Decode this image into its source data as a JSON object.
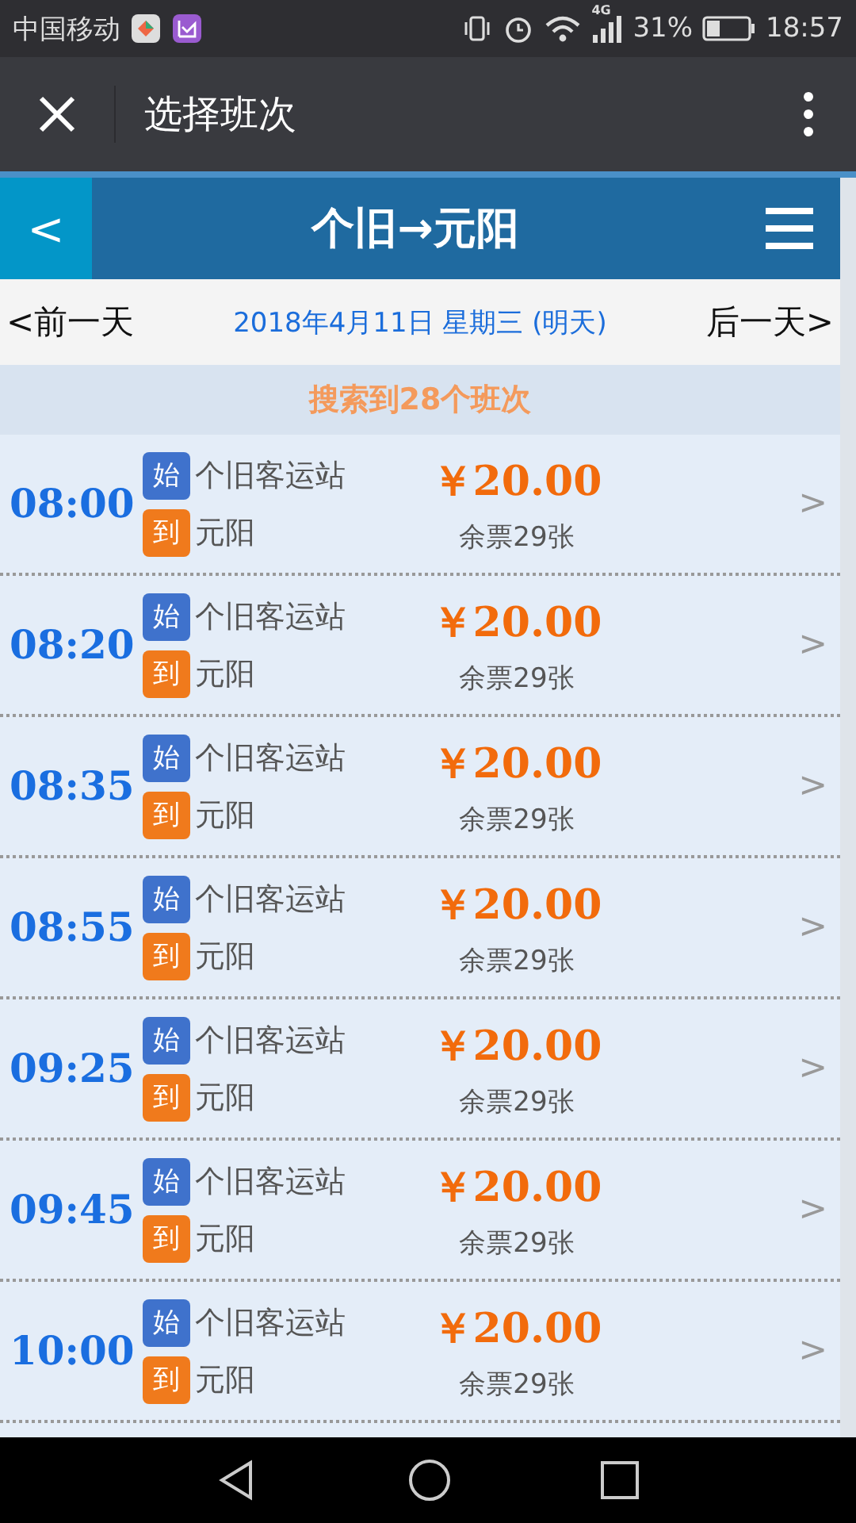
{
  "status_bar": {
    "carrier": "中国移动",
    "network": "4G",
    "battery": "31%",
    "time": "18:57"
  },
  "app_bar": {
    "title": "选择班次"
  },
  "header": {
    "back": "<",
    "title": "个旧→元阳"
  },
  "date_bar": {
    "prev": "<前一天",
    "date": "2018年4月11日 星期三 (明天)",
    "next": "后一天>"
  },
  "result_count": "搜索到28个班次",
  "trips": [
    {
      "time": "08:00",
      "from_badge": "始",
      "from": "个旧客运站",
      "to_badge": "到",
      "to": "元阳",
      "price": "￥20.00",
      "remaining": "余票29张",
      "chevron": ">"
    },
    {
      "time": "08:20",
      "from_badge": "始",
      "from": "个旧客运站",
      "to_badge": "到",
      "to": "元阳",
      "price": "￥20.00",
      "remaining": "余票29张",
      "chevron": ">"
    },
    {
      "time": "08:35",
      "from_badge": "始",
      "from": "个旧客运站",
      "to_badge": "到",
      "to": "元阳",
      "price": "￥20.00",
      "remaining": "余票29张",
      "chevron": ">"
    },
    {
      "time": "08:55",
      "from_badge": "始",
      "from": "个旧客运站",
      "to_badge": "到",
      "to": "元阳",
      "price": "￥20.00",
      "remaining": "余票29张",
      "chevron": ">"
    },
    {
      "time": "09:25",
      "from_badge": "始",
      "from": "个旧客运站",
      "to_badge": "到",
      "to": "元阳",
      "price": "￥20.00",
      "remaining": "余票29张",
      "chevron": ">"
    },
    {
      "time": "09:45",
      "from_badge": "始",
      "from": "个旧客运站",
      "to_badge": "到",
      "to": "元阳",
      "price": "￥20.00",
      "remaining": "余票29张",
      "chevron": ">"
    },
    {
      "time": "10:00",
      "from_badge": "始",
      "from": "个旧客运站",
      "to_badge": "到",
      "to": "元阳",
      "price": "￥20.00",
      "remaining": "余票29张",
      "chevron": ">"
    }
  ]
}
